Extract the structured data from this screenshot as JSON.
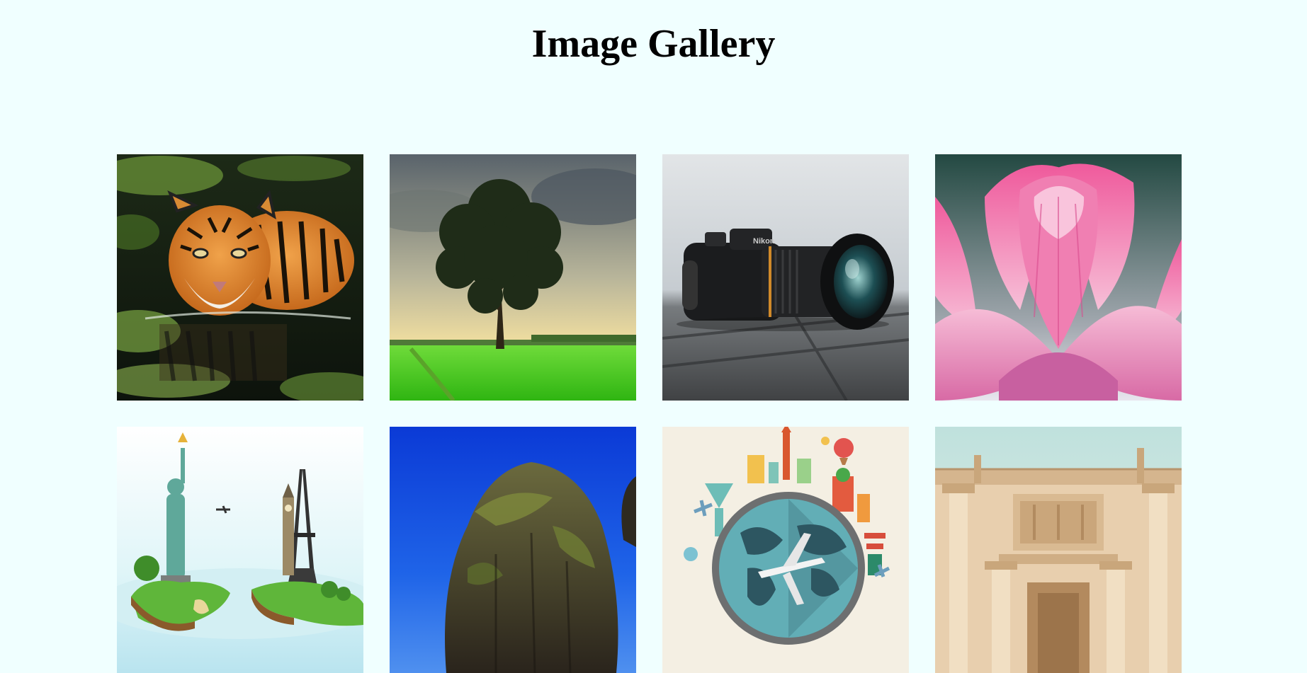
{
  "page": {
    "title": "Image Gallery",
    "background_color": "#f0ffff"
  },
  "gallery": {
    "images": [
      {
        "name": "tiger-image",
        "subject": "tiger swimming in green water"
      },
      {
        "name": "tree-field-image",
        "subject": "single tree in a green field at sunset"
      },
      {
        "name": "camera-image",
        "subject": "black DSLR camera on a wooden table"
      },
      {
        "name": "lotus-image",
        "subject": "pink lotus flower"
      },
      {
        "name": "landmarks-map-image",
        "subject": "world landmarks on a 3D map"
      },
      {
        "name": "rock-island-image",
        "subject": "rocky island under a blue sky"
      },
      {
        "name": "travel-globe-image",
        "subject": "travel illustration with a globe and airplane"
      },
      {
        "name": "ancient-library-image",
        "subject": "ancient stone building facade"
      }
    ]
  }
}
